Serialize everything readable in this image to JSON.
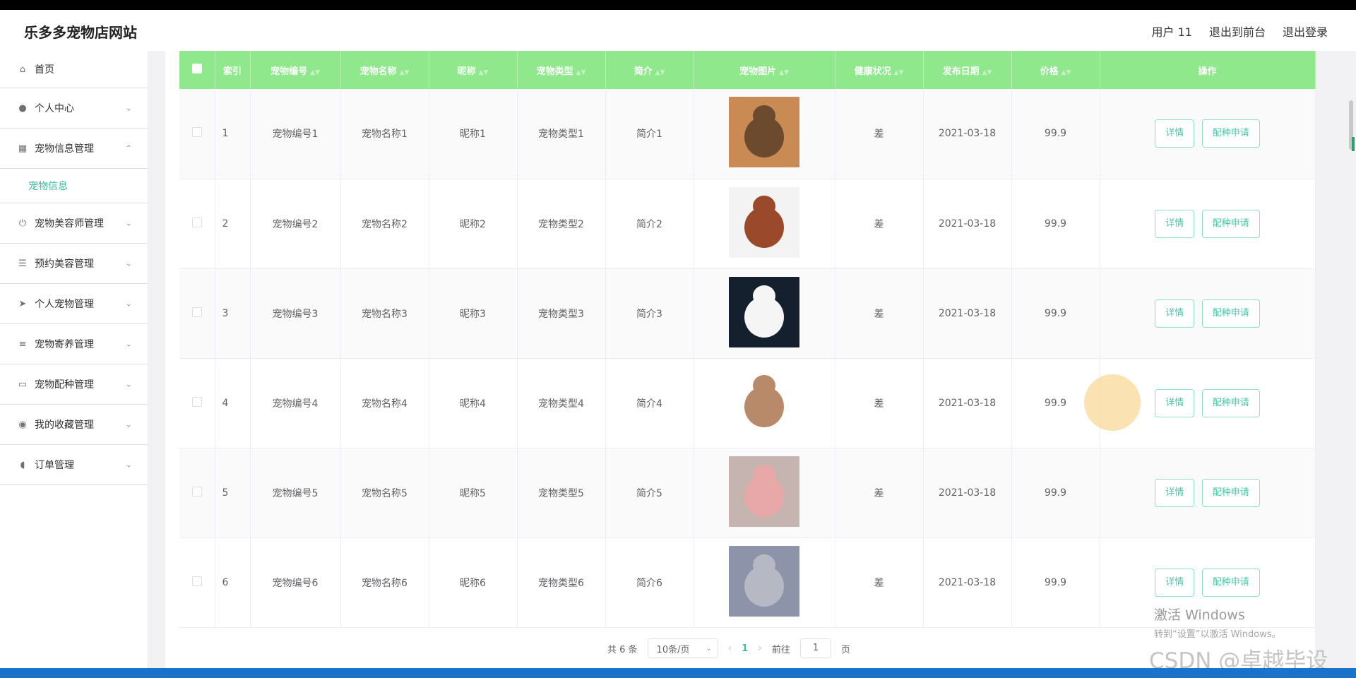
{
  "header": {
    "site_title": "乐多多宠物店网站",
    "user_label": "用户 11",
    "back_front_label": "退出到前台",
    "logout_label": "退出登录"
  },
  "sidebar": {
    "items": [
      {
        "label": "首页",
        "icon": "home-icon"
      },
      {
        "label": "个人中心",
        "icon": "user-icon"
      },
      {
        "label": "宠物信息管理",
        "icon": "grid-icon",
        "expanded": true
      },
      {
        "label": "宠物信息",
        "sub": true
      },
      {
        "label": "宠物美容师管理",
        "icon": "power-icon"
      },
      {
        "label": "预约美容管理",
        "icon": "list-icon"
      },
      {
        "label": "个人宠物管理",
        "icon": "send-icon"
      },
      {
        "label": "宠物寄养管理",
        "icon": "menu-icon"
      },
      {
        "label": "宠物配种管理",
        "icon": "chat-icon"
      },
      {
        "label": "我的收藏管理",
        "icon": "balloon-icon"
      },
      {
        "label": "订单管理",
        "icon": "mic-icon"
      }
    ]
  },
  "table": {
    "headers": [
      "索引",
      "宠物编号",
      "宠物名称",
      "昵称",
      "宠物类型",
      "简介",
      "宠物图片",
      "健康状况",
      "发布日期",
      "价格",
      "操作"
    ],
    "rows": [
      {
        "index": "1",
        "code": "宠物编号1",
        "name": "宠物名称1",
        "nick": "昵称1",
        "type": "宠物类型1",
        "intro": "简介1",
        "health": "差",
        "date": "2021-03-18",
        "price": "99.9"
      },
      {
        "index": "2",
        "code": "宠物编号2",
        "name": "宠物名称2",
        "nick": "昵称2",
        "type": "宠物类型2",
        "intro": "简介2",
        "health": "差",
        "date": "2021-03-18",
        "price": "99.9"
      },
      {
        "index": "3",
        "code": "宠物编号3",
        "name": "宠物名称3",
        "nick": "昵称3",
        "type": "宠物类型3",
        "intro": "简介3",
        "health": "差",
        "date": "2021-03-18",
        "price": "99.9"
      },
      {
        "index": "4",
        "code": "宠物编号4",
        "name": "宠物名称4",
        "nick": "昵称4",
        "type": "宠物类型4",
        "intro": "简介4",
        "health": "差",
        "date": "2021-03-18",
        "price": "99.9"
      },
      {
        "index": "5",
        "code": "宠物编号5",
        "name": "宠物名称5",
        "nick": "昵称5",
        "type": "宠物类型5",
        "intro": "简介5",
        "health": "差",
        "date": "2021-03-18",
        "price": "99.9"
      },
      {
        "index": "6",
        "code": "宠物编号6",
        "name": "宠物名称6",
        "nick": "昵称6",
        "type": "宠物类型6",
        "intro": "简介6",
        "health": "差",
        "date": "2021-03-18",
        "price": "99.9"
      }
    ],
    "detail_label": "详情",
    "breed_label": "配种申请"
  },
  "pager": {
    "total": "共 6 条",
    "page_size": "10条/页",
    "current": "1",
    "goto_label": "前往",
    "goto_value": "1",
    "page_suffix": "页"
  },
  "watermark": {
    "windows_title": "激活 Windows",
    "windows_sub": "转到“设置”以激活 Windows。",
    "csdn": "CSDN @卓越毕设"
  }
}
